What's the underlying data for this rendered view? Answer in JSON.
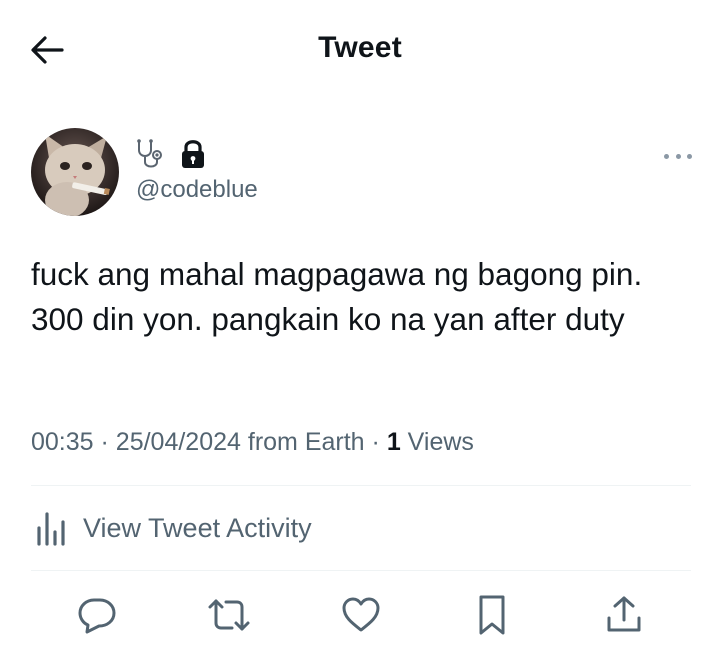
{
  "header": {
    "title": "Tweet",
    "back_icon": "arrow-left-icon"
  },
  "author": {
    "avatar": "cat-avatar",
    "name_icons": [
      "stethoscope-icon",
      "lock-icon"
    ],
    "handle": "@codeblue"
  },
  "tweet": {
    "text": "fuck ang mahal magpagawa ng bagong pin. 300 din yon. pangkain ko na yan after duty",
    "time": "00:35",
    "date": "25/04/2024",
    "source": "from Earth",
    "sep": "·",
    "views_count": "1",
    "views_label": "Views"
  },
  "activity": {
    "label": "View Tweet Activity",
    "icon": "bar-chart-icon"
  },
  "actions": [
    "reply-icon",
    "retweet-icon",
    "like-icon",
    "bookmark-icon",
    "share-icon"
  ],
  "colors": {
    "text": "#0f1419",
    "secondary": "#536471",
    "divider": "#eff3f4"
  }
}
